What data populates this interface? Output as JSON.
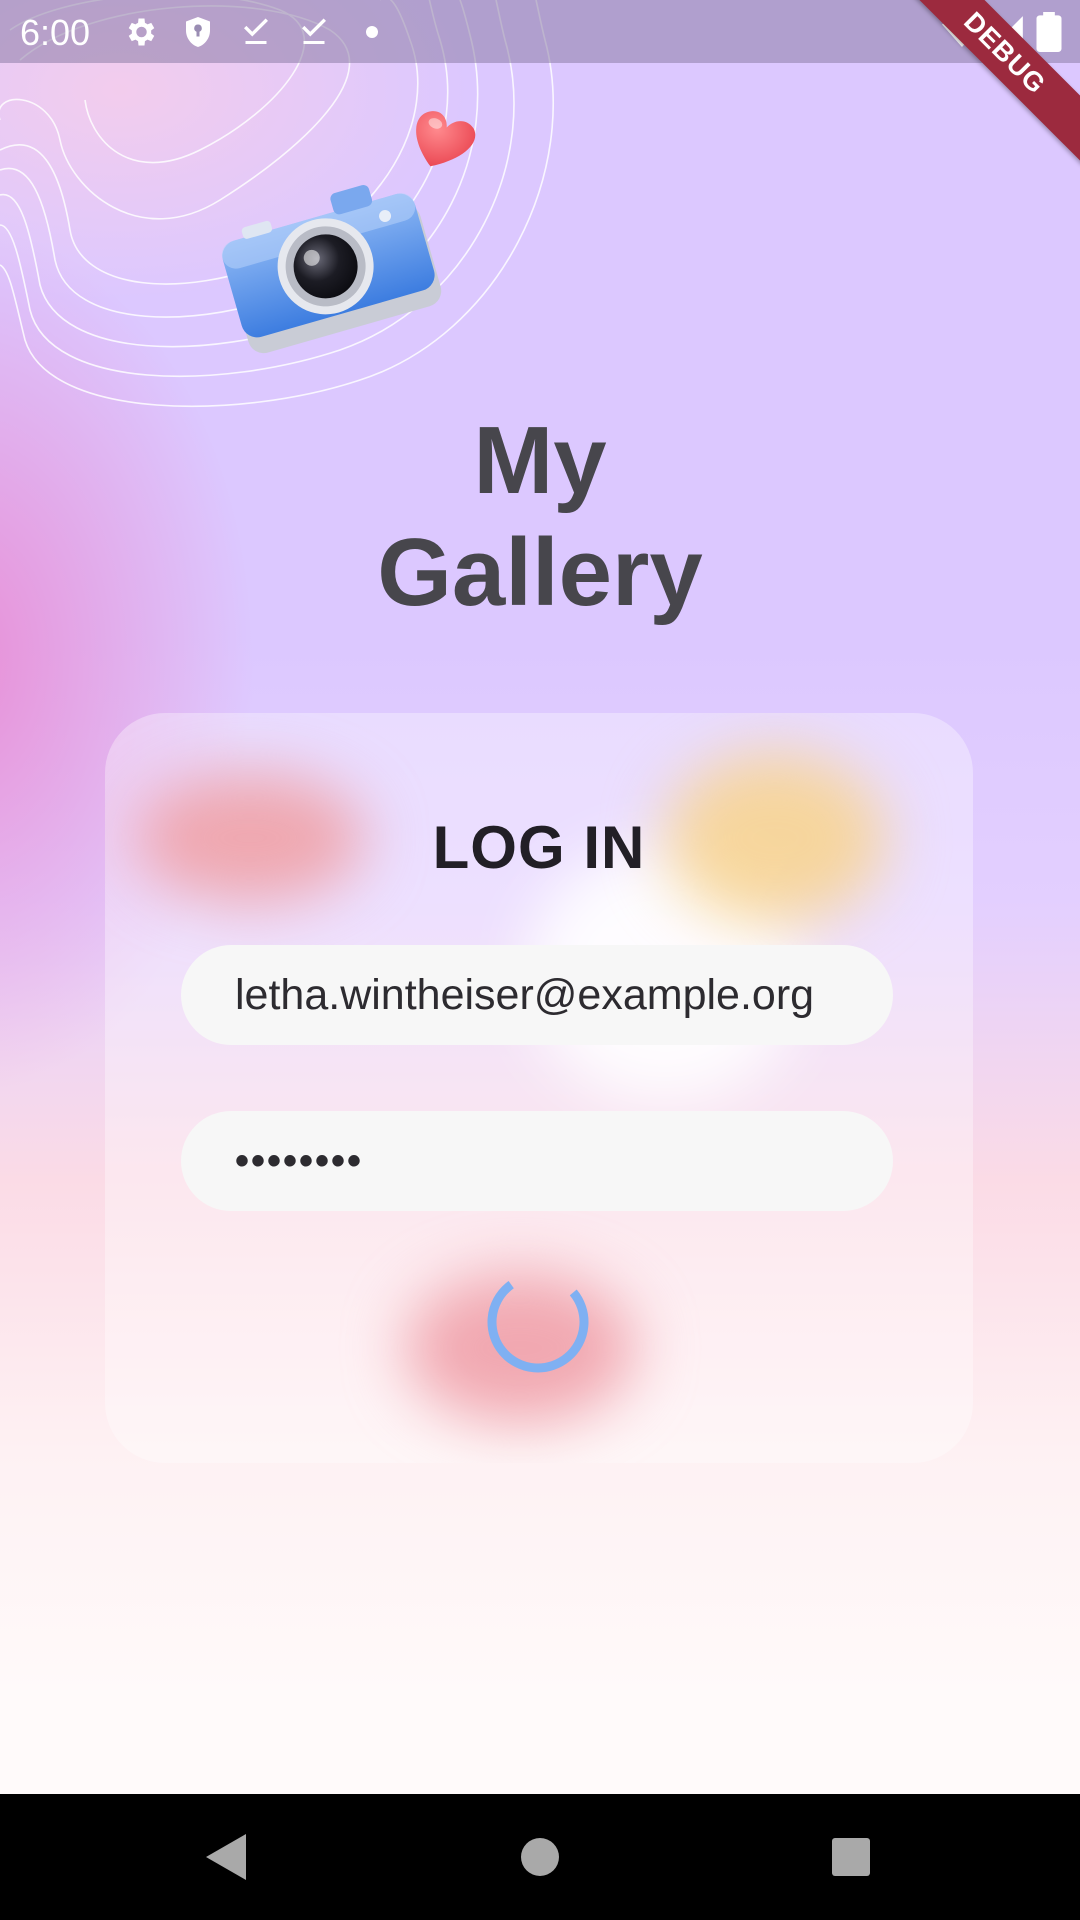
{
  "status_bar": {
    "time": "6:00",
    "left_icons": [
      "gear-icon",
      "shield-icon",
      "download-done-icon",
      "download-done-icon",
      "dot-icon"
    ],
    "right_icons": [
      "wifi-icon",
      "signal-icon",
      "battery-icon"
    ]
  },
  "debug_banner": "DEBUG",
  "app": {
    "title_line1": "My",
    "title_line2": "Gallery",
    "illustration": "camera-with-heart-icon"
  },
  "login": {
    "heading": "LOG IN",
    "email_value": "letha.wintheiser@example.org",
    "password_value": "••••••••",
    "submit_state": "loading"
  },
  "colors": {
    "title": "#47464c",
    "heading": "#221f26",
    "spinner": "#7fb0f2",
    "field_bg": "#f7f7f7",
    "debug_banner": "#9c2a3e"
  },
  "nav_bar": {
    "buttons": [
      "back-icon",
      "home-icon",
      "recents-icon"
    ]
  }
}
